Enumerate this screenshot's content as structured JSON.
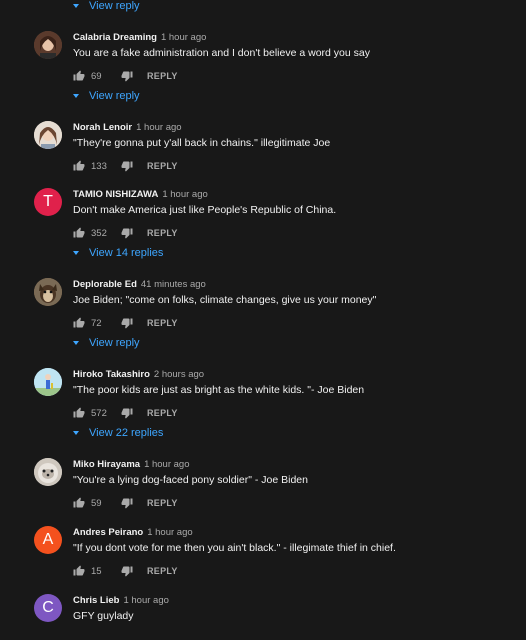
{
  "top_view_reply": "View reply",
  "comments": [
    {
      "author": "Calabria Dreaming",
      "time": "1 hour ago",
      "text": "You are a fake administration and I don't believe a word you say",
      "likes": "69",
      "reply_label": "REPLY",
      "view_replies": "View reply",
      "avatar": {
        "type": "photo",
        "bg": "#6b4a3a"
      }
    },
    {
      "author": "Norah Lenoir",
      "time": "1 hour ago",
      "text": "\"They're gonna put y'all back in chains.\" illegitimate Joe",
      "likes": "133",
      "reply_label": "REPLY",
      "view_replies": "",
      "avatar": {
        "type": "photo",
        "bg": "#c9b8a8"
      }
    },
    {
      "author": "TAMIO NISHIZAWA",
      "time": "1 hour ago",
      "text": "Don't make America just like People's Republic of China.",
      "likes": "352",
      "reply_label": "REPLY",
      "view_replies": "View 14 replies",
      "avatar": {
        "type": "letter",
        "letter": "T",
        "bg": "#e0214b"
      }
    },
    {
      "author": "Deplorable Ed",
      "time": "41 minutes ago",
      "text": "Joe Biden; \"come on folks, climate changes, give us your money\"",
      "likes": "72",
      "reply_label": "REPLY",
      "view_replies": "View reply",
      "avatar": {
        "type": "photo",
        "bg": "#8a6a45"
      }
    },
    {
      "author": "Hiroko Takashiro",
      "time": "2 hours ago",
      "text": "\"The poor kids are just as bright as the white kids. \"- Joe Biden",
      "likes": "572",
      "reply_label": "REPLY",
      "view_replies": "View 22 replies",
      "avatar": {
        "type": "photo",
        "bg": "#9fd3e6"
      }
    },
    {
      "author": "Miko Hirayama",
      "time": "1 hour ago",
      "text": "\"You're a lying dog-faced pony soldier\" - Joe Biden",
      "likes": "59",
      "reply_label": "REPLY",
      "view_replies": "",
      "avatar": {
        "type": "photo",
        "bg": "#b9b2aa"
      }
    },
    {
      "author": "Andres Peirano",
      "time": "1 hour ago",
      "text": "\"If you dont vote for me then you ain't black.\" - illegimate  thief in chief.",
      "likes": "15",
      "reply_label": "REPLY",
      "view_replies": "",
      "avatar": {
        "type": "letter",
        "letter": "A",
        "bg": "#f4511e"
      }
    },
    {
      "author": "Chris Lieb",
      "time": "1 hour ago",
      "text": "GFY guylady",
      "likes": "",
      "reply_label": "",
      "view_replies": "",
      "avatar": {
        "type": "letter",
        "letter": "C",
        "bg": "#7e57c2"
      }
    }
  ],
  "colors": {
    "background": "#181818",
    "link": "#3ea6ff",
    "muted": "#aaaaaa",
    "text": "#f1f1f1"
  },
  "icons": {
    "like": "thumbs-up-icon",
    "dislike": "thumbs-down-icon",
    "expand": "caret-down-icon"
  }
}
